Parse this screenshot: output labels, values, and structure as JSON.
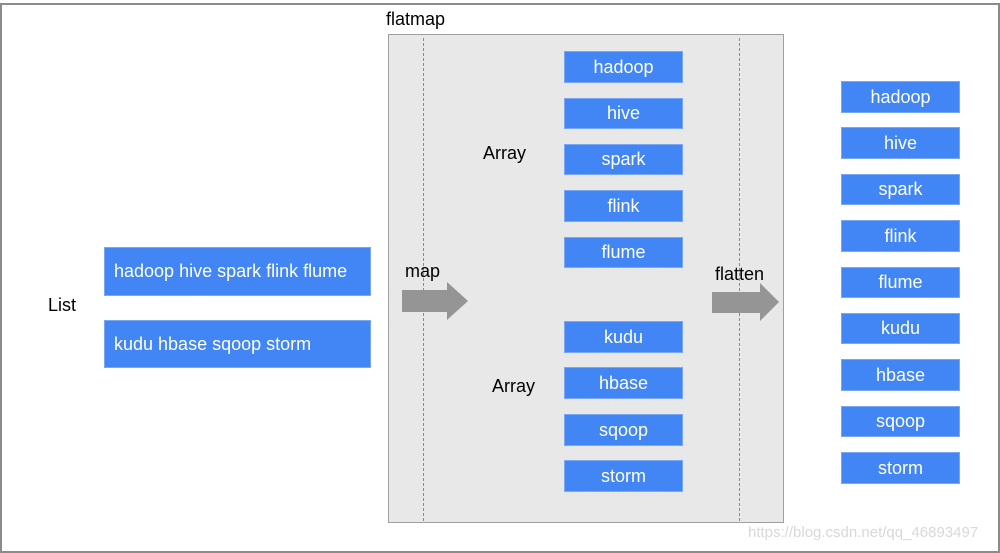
{
  "diagram": {
    "title": "flatmap",
    "list_label": "List",
    "list_items": [
      "hadoop hive spark flink flume",
      "kudu hbase sqoop storm"
    ],
    "map_label": "map",
    "flatten_label": "flatten",
    "array_label": "Array",
    "arrays": [
      [
        "hadoop",
        "hive",
        "spark",
        "flink",
        "flume"
      ],
      [
        "kudu",
        "hbase",
        "sqoop",
        "storm"
      ]
    ],
    "flattened": [
      "hadoop",
      "hive",
      "spark",
      "flink",
      "flume",
      "kudu",
      "hbase",
      "sqoop",
      "storm"
    ],
    "colors": {
      "box": "#4285f4",
      "panel": "#e8e8e8",
      "arrow": "#959595"
    }
  },
  "watermark": "https://blog.csdn.net/qq_46893497"
}
